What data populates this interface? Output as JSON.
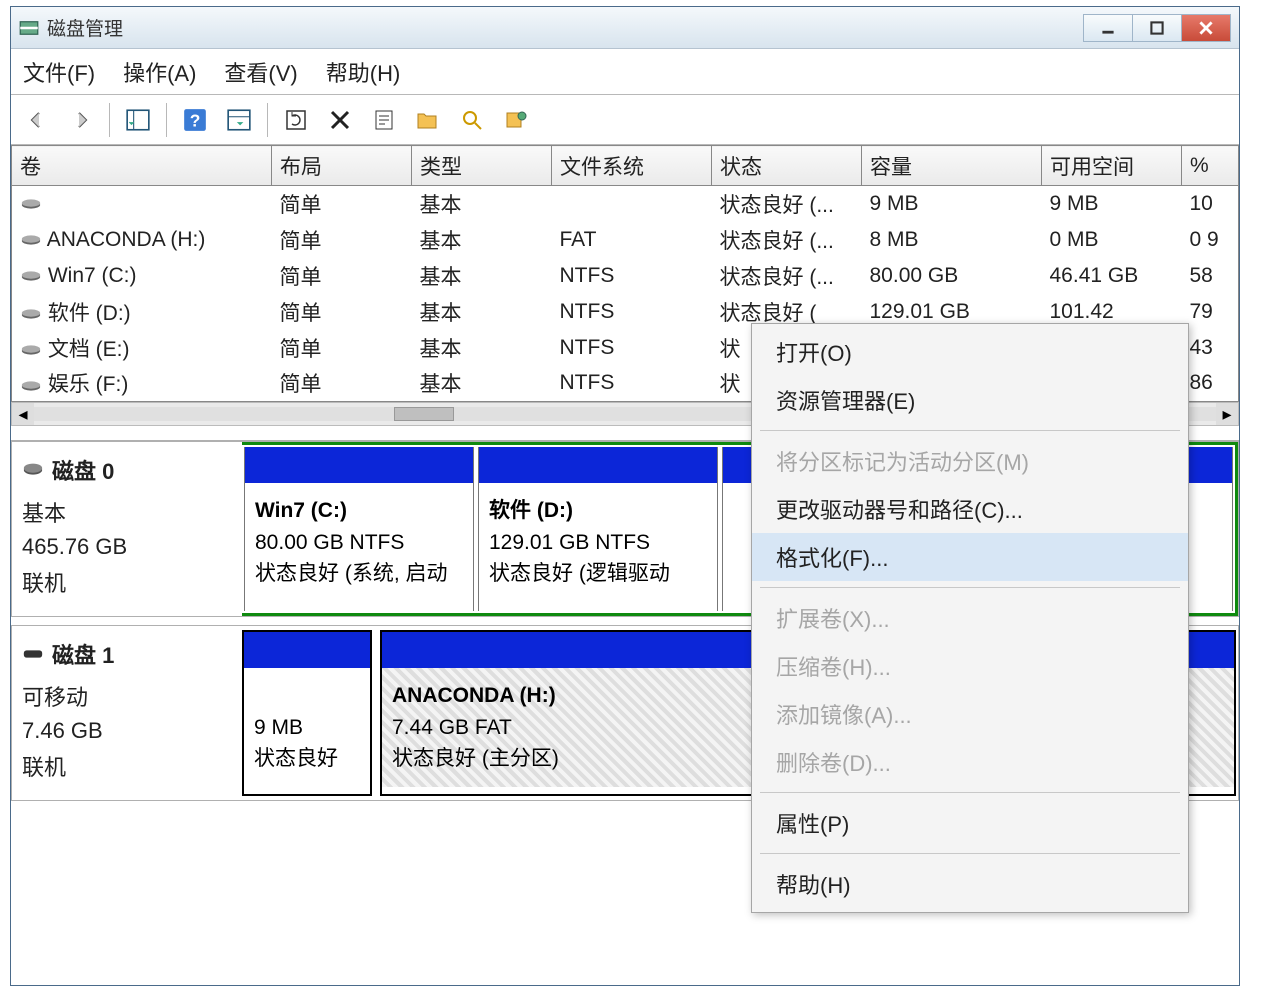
{
  "window": {
    "title": "磁盘管理"
  },
  "menu": {
    "file": "文件(F)",
    "action": "操作(A)",
    "view": "查看(V)",
    "help": "帮助(H)"
  },
  "table": {
    "headers": {
      "volume": "卷",
      "layout": "布局",
      "type": "类型",
      "filesystem": "文件系统",
      "status": "状态",
      "capacity": "容量",
      "freespace": "可用空间",
      "percent": "%"
    },
    "rows": [
      {
        "volume": "",
        "layout": "简单",
        "type": "基本",
        "fs": "",
        "status": "状态良好 (...",
        "capacity": "9 MB",
        "free": "9 MB",
        "percent": "10"
      },
      {
        "volume": "ANACONDA (H:)",
        "layout": "简单",
        "type": "基本",
        "fs": "FAT",
        "status": "状态良好 (...",
        "capacity": "8 MB",
        "free": "0 MB",
        "percent": "0 9"
      },
      {
        "volume": "Win7 (C:)",
        "layout": "简单",
        "type": "基本",
        "fs": "NTFS",
        "status": "状态良好 (...",
        "capacity": "80.00 GB",
        "free": "46.41 GB",
        "percent": "58"
      },
      {
        "volume": "软件 (D:)",
        "layout": "简单",
        "type": "基本",
        "fs": "NTFS",
        "status": "状态良好 (",
        "capacity": "129.01 GB",
        "free": "101.42",
        "percent": "79"
      },
      {
        "volume": "文档 (E:)",
        "layout": "简单",
        "type": "基本",
        "fs": "NTFS",
        "status": "状",
        "capacity": "",
        "free": "",
        "percent": "43"
      },
      {
        "volume": "娱乐 (F:)",
        "layout": "简单",
        "type": "基本",
        "fs": "NTFS",
        "status": "状",
        "capacity": "",
        "free": "",
        "percent": "86"
      }
    ]
  },
  "disks": {
    "d0": {
      "name": "磁盘 0",
      "type": "基本",
      "size": "465.76 GB",
      "state": "联机",
      "partitions": [
        {
          "title": "Win7  (C:)",
          "size": "80.00 GB NTFS",
          "status": "状态良好 (系统, 启动"
        },
        {
          "title": "软件  (D:)",
          "size": "129.01 GB NTFS",
          "status": "状态良好 (逻辑驱动"
        },
        {
          "title": "",
          "size": "",
          "status": ""
        }
      ]
    },
    "d1": {
      "name": "磁盘 1",
      "type": "可移动",
      "size": "7.46 GB",
      "state": "联机",
      "partitions": [
        {
          "title": "",
          "size": "9 MB",
          "status": "状态良好"
        },
        {
          "title": "ANACONDA  (H:)",
          "size": "7.44 GB FAT",
          "status": "状态良好 (主分区)"
        }
      ]
    }
  },
  "context_menu": {
    "open": "打开(O)",
    "explorer": "资源管理器(E)",
    "mark_active": "将分区标记为活动分区(M)",
    "change_letter": "更改驱动器号和路径(C)...",
    "format": "格式化(F)...",
    "extend": "扩展卷(X)...",
    "shrink": "压缩卷(H)...",
    "mirror": "添加镜像(A)...",
    "delete_vol": "删除卷(D)...",
    "properties": "属性(P)",
    "help": "帮助(H)"
  }
}
